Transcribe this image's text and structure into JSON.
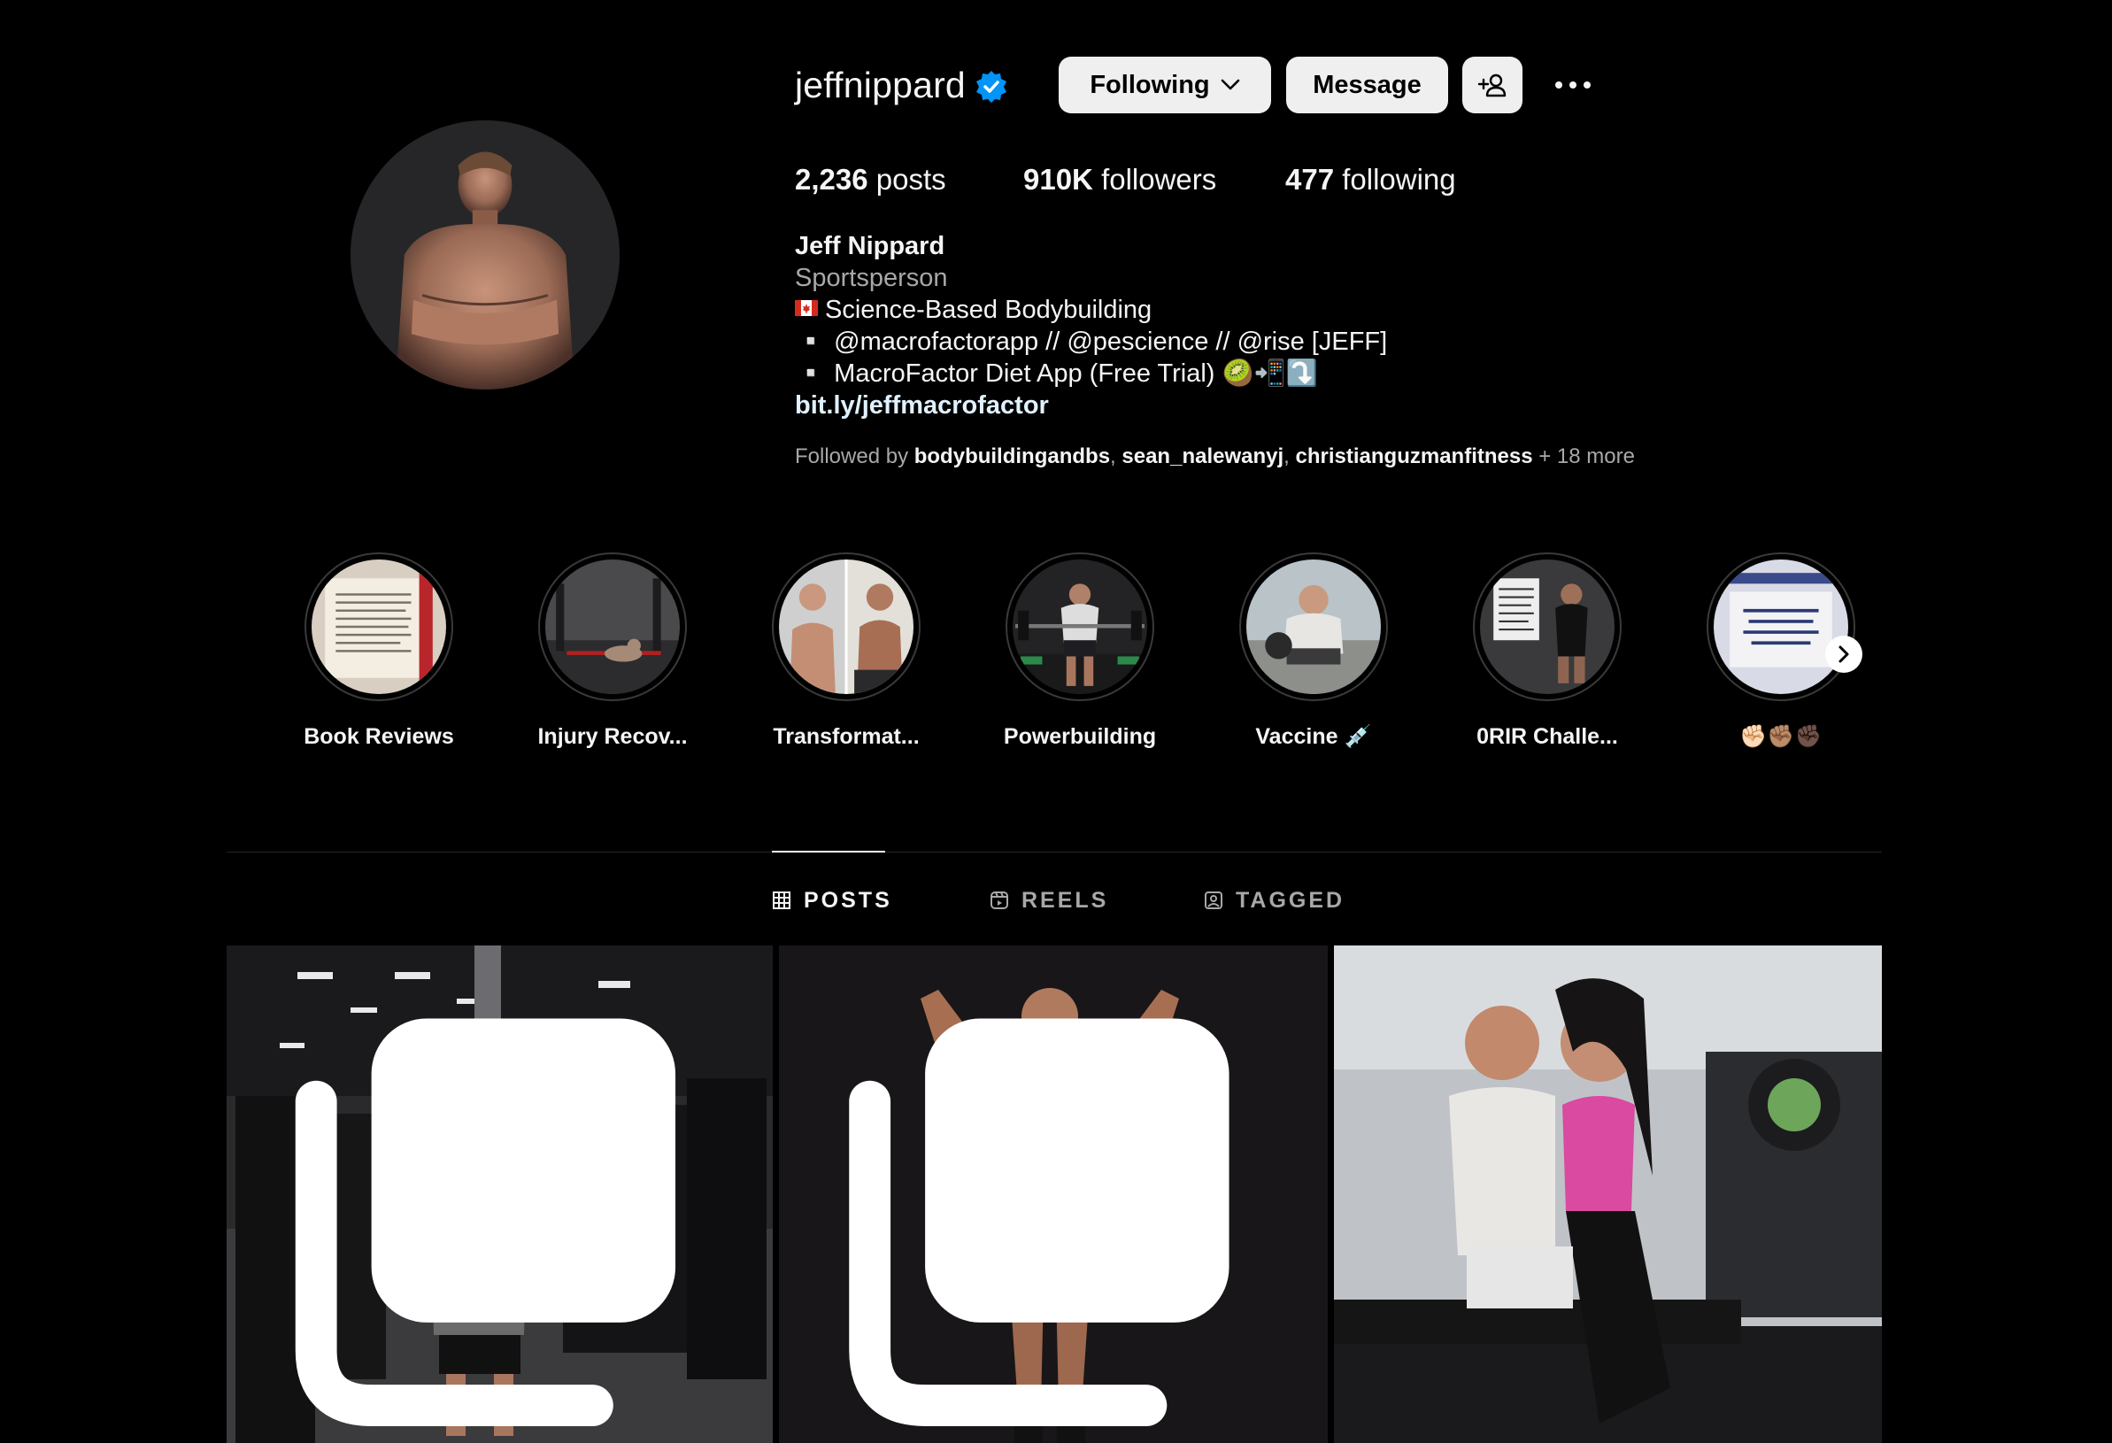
{
  "profile": {
    "username": "jeffnippard",
    "verified": true,
    "buttons": {
      "following": "Following",
      "message": "Message"
    },
    "stats": {
      "posts_count": "2,236",
      "posts_label": "posts",
      "followers_count": "910K",
      "followers_label": "followers",
      "following_count": "477",
      "following_label": "following"
    },
    "bio": {
      "name": "Jeff Nippard",
      "category": "Sportsperson",
      "line1": "Science-Based Bodybuilding",
      "line2": "▫️ @macrofactorapp // @pescience // @rise [JEFF]",
      "line3": "▫️ MacroFactor Diet App (Free Trial) 🥝📲⤵️",
      "link": "bit.ly/jeffmacrofactor"
    },
    "followed_by": {
      "prefix": "Followed by ",
      "users": [
        "bodybuildingandbs",
        "sean_nalewanyj",
        "christianguzmanfitness"
      ],
      "suffix": " + 18 more"
    }
  },
  "highlights": [
    {
      "label": "Book Reviews"
    },
    {
      "label": "Injury Recov..."
    },
    {
      "label": "Transformat..."
    },
    {
      "label": "Powerbuilding"
    },
    {
      "label": "Vaccine 💉"
    },
    {
      "label": "0RIR Challe..."
    },
    {
      "label": "✊🏻✊🏽✊🏿"
    }
  ],
  "tabs": [
    {
      "label": "POSTS",
      "icon": "grid-icon",
      "active": true
    },
    {
      "label": "REELS",
      "icon": "reels-icon",
      "active": false
    },
    {
      "label": "TAGGED",
      "icon": "tagged-icon",
      "active": false
    }
  ],
  "posts": [
    {
      "type": "carousel",
      "description_icon": "multiple-images-icon"
    },
    {
      "type": "carousel",
      "description_icon": "multiple-images-icon"
    },
    {
      "type": "single"
    }
  ],
  "colors": {
    "background": "#000000",
    "button_bg": "#efefef",
    "verified_blue": "#0095f6",
    "muted_text": "#a8a8a8",
    "link_text": "#e0f1ff"
  }
}
